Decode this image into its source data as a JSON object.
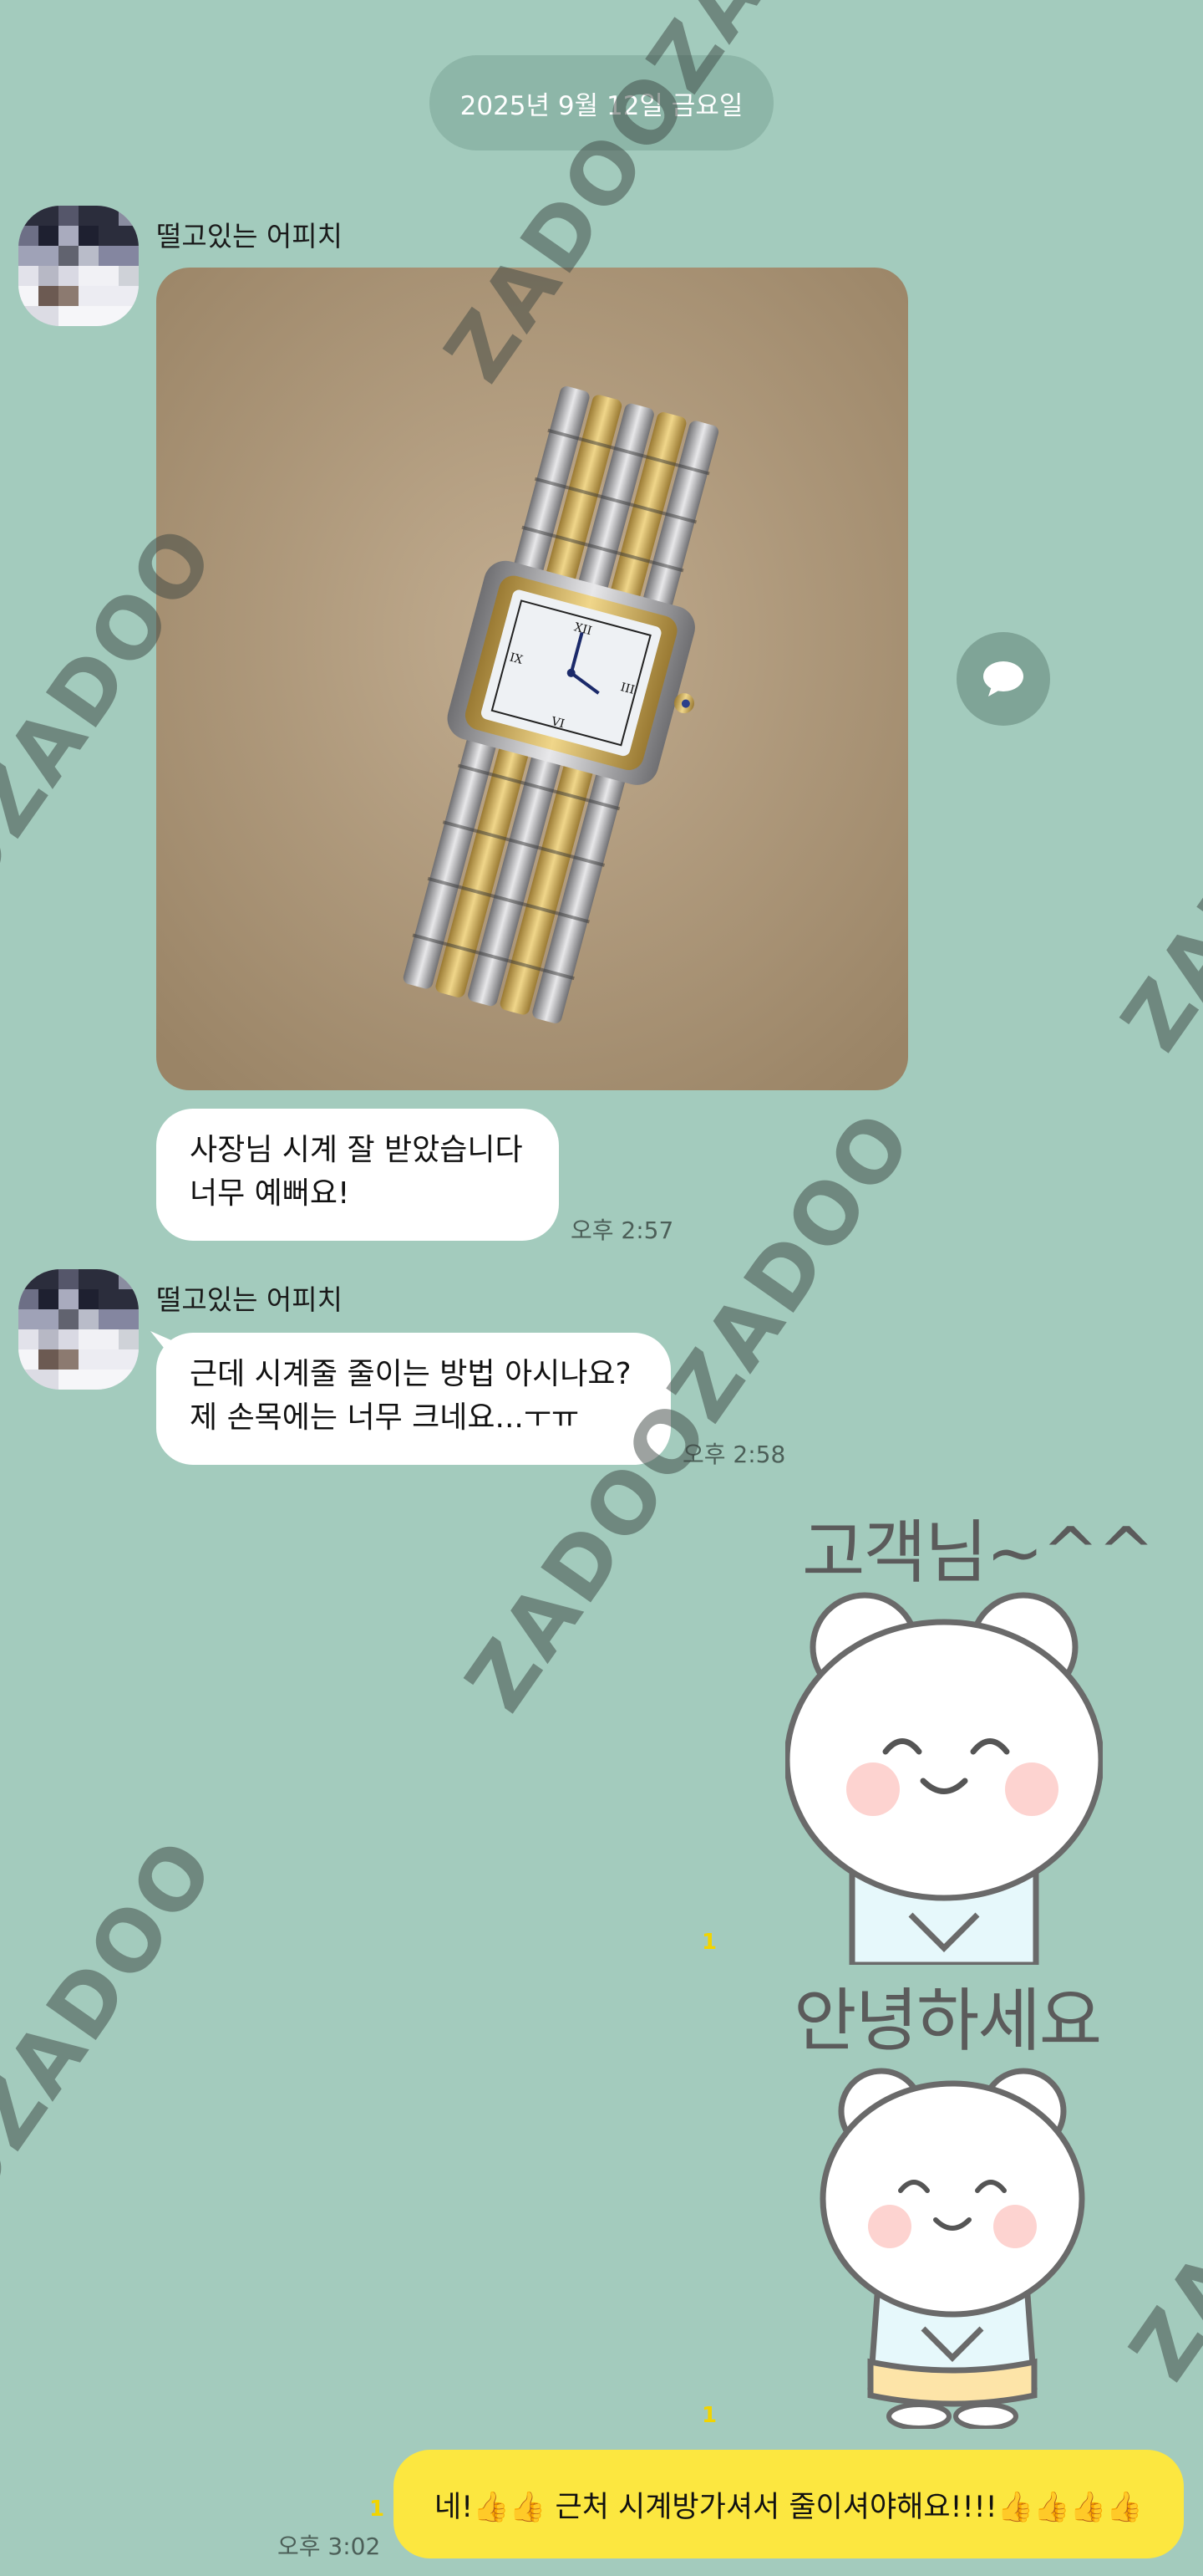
{
  "date_divider": "2025년 9월 12일 금요일",
  "watermark": "ZADOOZADOO",
  "messages": [
    {
      "sender": "떨고있는 어피치",
      "text_lines": [
        "사장님 시계 잘 받았습니다",
        "너무 예뻐요!"
      ],
      "time": "오후 2:57"
    },
    {
      "sender": "떨고있는 어피치",
      "text_lines": [
        "근데 시계줄 줄이는 방법 아시나요?",
        "제 손목에는 너무 크네요...ㅜㅠ"
      ],
      "time": "오후 2:58"
    }
  ],
  "stickers": [
    {
      "text": "고객님~^^",
      "unread": "1"
    },
    {
      "text": "안녕하세요",
      "unread": "1"
    }
  ],
  "my_message": {
    "text": "네!👍👍 근처 시계방가셔서 줄이셔야해요!!!!👍👍👍👍",
    "time": "오후 3:02",
    "unread": "1"
  },
  "icons": {
    "share": "chat-bubble-icon"
  },
  "colors": {
    "background": "#a3cbbd",
    "my_bubble": "#fce740",
    "their_bubble": "#ffffff",
    "unread": "#f2d400"
  }
}
